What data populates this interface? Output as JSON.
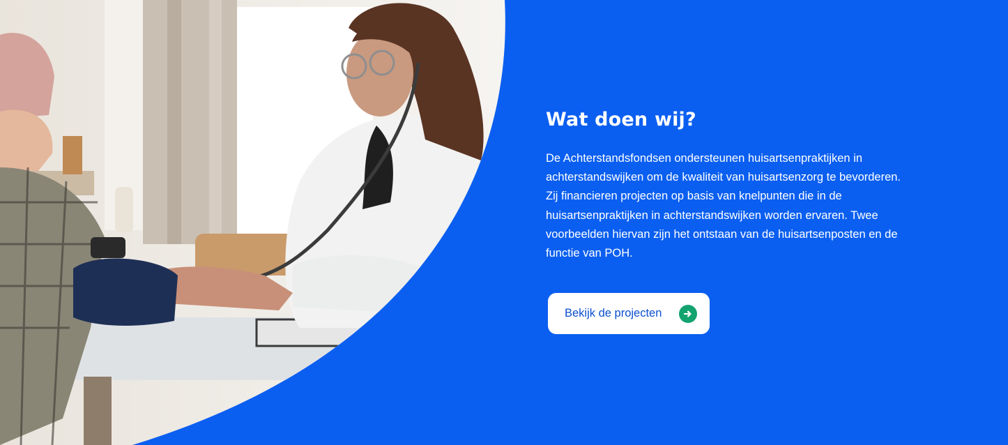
{
  "section": {
    "title": "Wat doen wij?",
    "body": "De Achterstandsfondsen ondersteunen huisartsenpraktijken in achterstandswijken om de kwaliteit van huisartsenzorg te bevorderen. Zij financieren projecten op basis van knelpunten die in de huisartsenpraktijken in achterstandswijken worden ervaren. Twee voorbeelden hiervan zijn het ontstaan van de huisartsenposten en de functie van POH.",
    "cta_label": "Bekijk de projecten",
    "cta_icon": "arrow-right-circle-icon"
  },
  "colors": {
    "background": "#0b5ff0",
    "button_text": "#0b4fcf",
    "icon_accent": "#12a36f"
  }
}
